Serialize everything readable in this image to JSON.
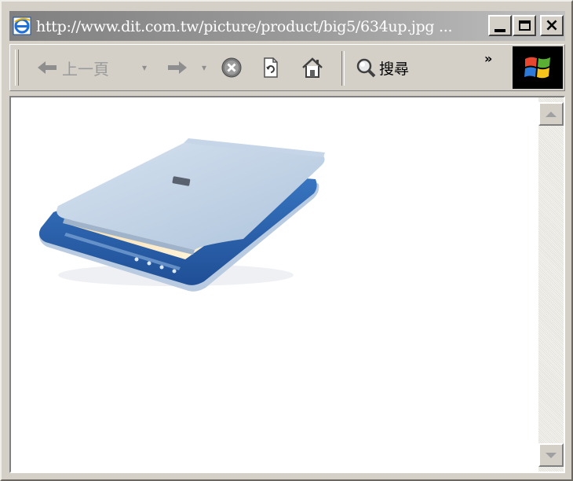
{
  "window": {
    "title": "http://www.dit.com.tw/picture/product/big5/634up.jpg ...",
    "minimize_label": "minimize",
    "maximize_label": "maximize",
    "close_label": "×"
  },
  "toolbar": {
    "back_label": "上一頁",
    "back_dropdown": "▾",
    "forward_dropdown": "▾",
    "search_label": "搜尋",
    "more_label": "»"
  },
  "icons": {
    "app": "ie-icon",
    "back": "back-arrow-icon",
    "forward": "forward-arrow-icon",
    "stop": "stop-icon",
    "refresh": "refresh-icon",
    "home": "home-icon",
    "search": "search-icon",
    "throbber": "windows-logo-icon",
    "image": "scanner-image"
  },
  "colors": {
    "title_bar_start": "#808080",
    "title_bar_end": "#c0c0c0",
    "chrome": "#d4d0c8",
    "content_background": "#ffffff",
    "scanner_lid": "#b9cde2",
    "scanner_base": "#2f66b0"
  }
}
